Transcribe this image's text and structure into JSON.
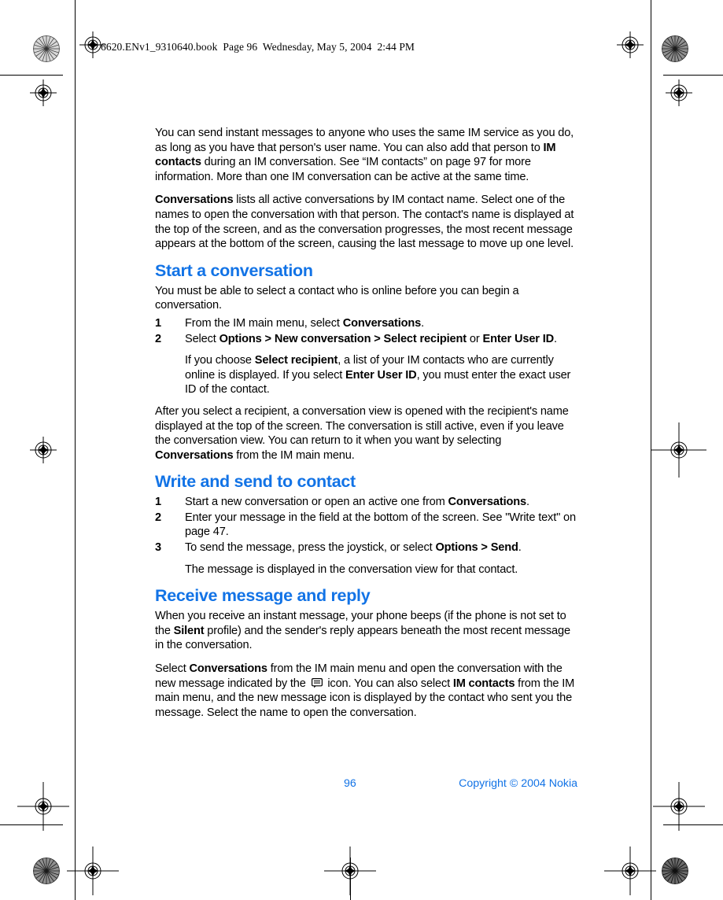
{
  "header": {
    "text": "6620.ENv1_9310640.book  Page 96  Wednesday, May 5, 2004  2:44 PM"
  },
  "colors": {
    "heading_blue": "#1273E6",
    "body_black": "#000000",
    "page_background": "#FFFFFF"
  },
  "content": {
    "intro_paragraph_1": {
      "part1": "You can send instant messages to anyone who uses the same IM service as you do, as long as you have that person's user name. You can also add that person to ",
      "bold1": "IM contacts",
      "part2": " during an IM conversation. See “IM contacts” on page 97 for more information. More than one IM conversation can be active at the same time."
    },
    "intro_paragraph_2": {
      "bold1": "Conversations",
      "part1": " lists all active conversations by IM contact name. Select one of the names to open the conversation with that person. The contact's name is displayed at the top of the screen, and as the conversation progresses, the most recent message appears at the bottom of the screen, causing the last message to move up one level."
    },
    "sections": [
      {
        "heading": "Start a conversation",
        "lead": "You must be able to select a contact who is online before you can begin a conversation.",
        "steps": [
          {
            "num": "1",
            "part1": "From the IM main menu, select ",
            "bold1": "Conversations",
            "part2": "."
          },
          {
            "num": "2",
            "part1": "Select ",
            "bold1": "Options > New conversation > Select recipient",
            "part2": " or ",
            "bold2": "Enter User ID",
            "part3": "."
          }
        ],
        "substep": {
          "part1": "If you choose ",
          "bold1": "Select recipient",
          "part2": ", a list of your IM contacts who are currently online is displayed. If you select ",
          "bold2": "Enter User ID",
          "part3": ", you must enter the exact user ID of the contact."
        },
        "closing": {
          "part1": "After you select a recipient, a conversation view is opened with the recipient's name displayed at the top of the screen. The conversation is still active, even if you leave the conversation view. You can return to it when you want by selecting ",
          "bold1": "Conversations",
          "part2": " from the IM main menu."
        }
      },
      {
        "heading": "Write and send to contact",
        "steps": [
          {
            "num": "1",
            "part1": "Start a new conversation or open an active one from ",
            "bold1": "Conversations",
            "part2": "."
          },
          {
            "num": "2",
            "part1": "Enter your message in the field at the bottom of the screen. See \"Write text\" on page 47.",
            "bold1": "",
            "part2": ""
          },
          {
            "num": "3",
            "part1": "To send the message, press the joystick, or select ",
            "bold1": "Options > Send",
            "part2": "."
          }
        ],
        "substep": {
          "part1": "The message is displayed in the conversation view for that contact.",
          "bold1": "",
          "part2": ""
        }
      },
      {
        "heading": "Receive message and reply",
        "para1": {
          "part1": "When you receive an instant message, your phone beeps (if the phone is not set to the ",
          "bold1": "Silent",
          "part2": " profile) and the sender's reply appears beneath the most recent message in the conversation."
        },
        "para2": {
          "part1": "Select ",
          "bold1": "Conversations",
          "part2": " from the IM main menu and open the conversation with the new message indicated by the ",
          "icon": "new-message-bubble-icon",
          "part3": " icon. You can also select ",
          "bold2": "IM contacts",
          "part4": " from the IM main menu, and the new message icon is displayed by the contact who sent you the message. Select the name to open the conversation."
        }
      }
    ]
  },
  "footer": {
    "page_number": "96",
    "copyright": "Copyright © 2004 Nokia"
  }
}
